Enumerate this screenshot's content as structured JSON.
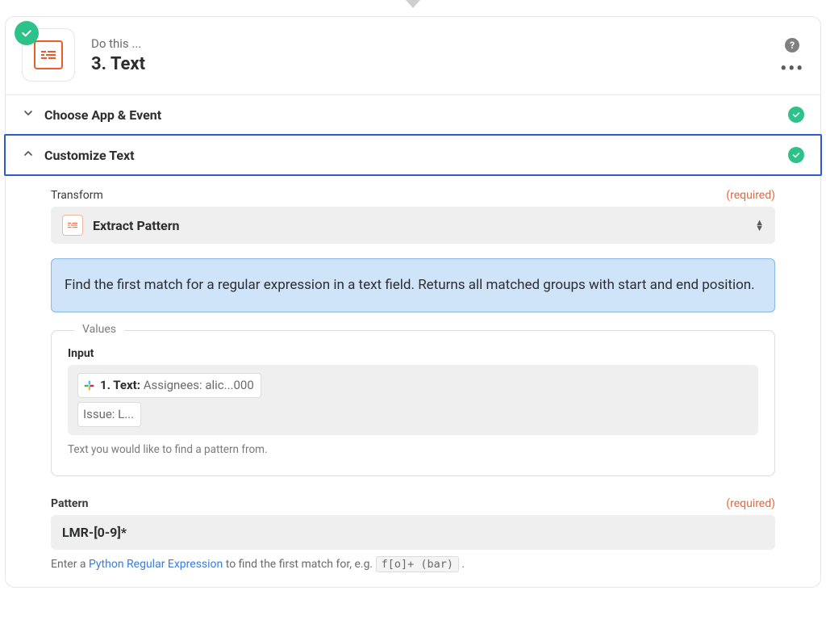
{
  "header": {
    "kicker": "Do this ...",
    "title": "3. Text"
  },
  "sections": {
    "choose_app_event": "Choose App & Event",
    "customize_text": "Customize Text"
  },
  "transform": {
    "label": "Transform",
    "required": "(required)",
    "value": "Extract Pattern",
    "description": "Find the first match for a regular expression in a text field. Returns all matched groups with start and end position."
  },
  "values": {
    "legend": "Values",
    "input_label": "Input",
    "pill_prefix": "1. Text: ",
    "pill_value": "Assignees: alic...000",
    "extra_line": "Issue: L...",
    "hint": "Text you would like to find a pattern from."
  },
  "pattern": {
    "label": "Pattern",
    "required": "(required)",
    "value": "LMR-[0-9]*",
    "helper_prefix": "Enter a ",
    "helper_link": "Python Regular Expression",
    "helper_suffix": " to find the first match for, e.g. ",
    "helper_code": "f[o]+ (bar)",
    "helper_tail": " ."
  }
}
